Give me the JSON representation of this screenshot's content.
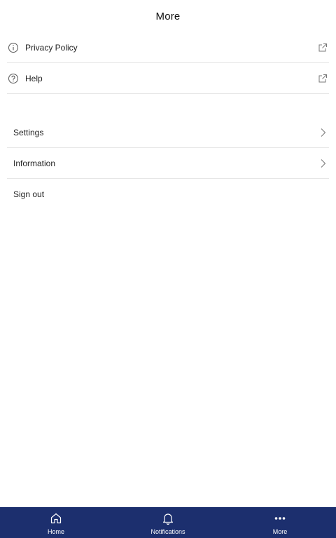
{
  "header": {
    "title": "More"
  },
  "links": [
    {
      "label": "Privacy Policy",
      "icon": "info-icon",
      "trailing": "external-link-icon"
    },
    {
      "label": "Help",
      "icon": "help-icon",
      "trailing": "external-link-icon"
    }
  ],
  "menu": [
    {
      "label": "Settings",
      "trailing": "chevron-right-icon"
    },
    {
      "label": "Information",
      "trailing": "chevron-right-icon"
    },
    {
      "label": "Sign out"
    }
  ],
  "tabbar": {
    "tabs": [
      {
        "label": "Home",
        "icon": "home-icon"
      },
      {
        "label": "Notifications",
        "icon": "bell-icon"
      },
      {
        "label": "More",
        "icon": "more-icon"
      }
    ],
    "active": "More",
    "background": "#1c2f6e"
  }
}
